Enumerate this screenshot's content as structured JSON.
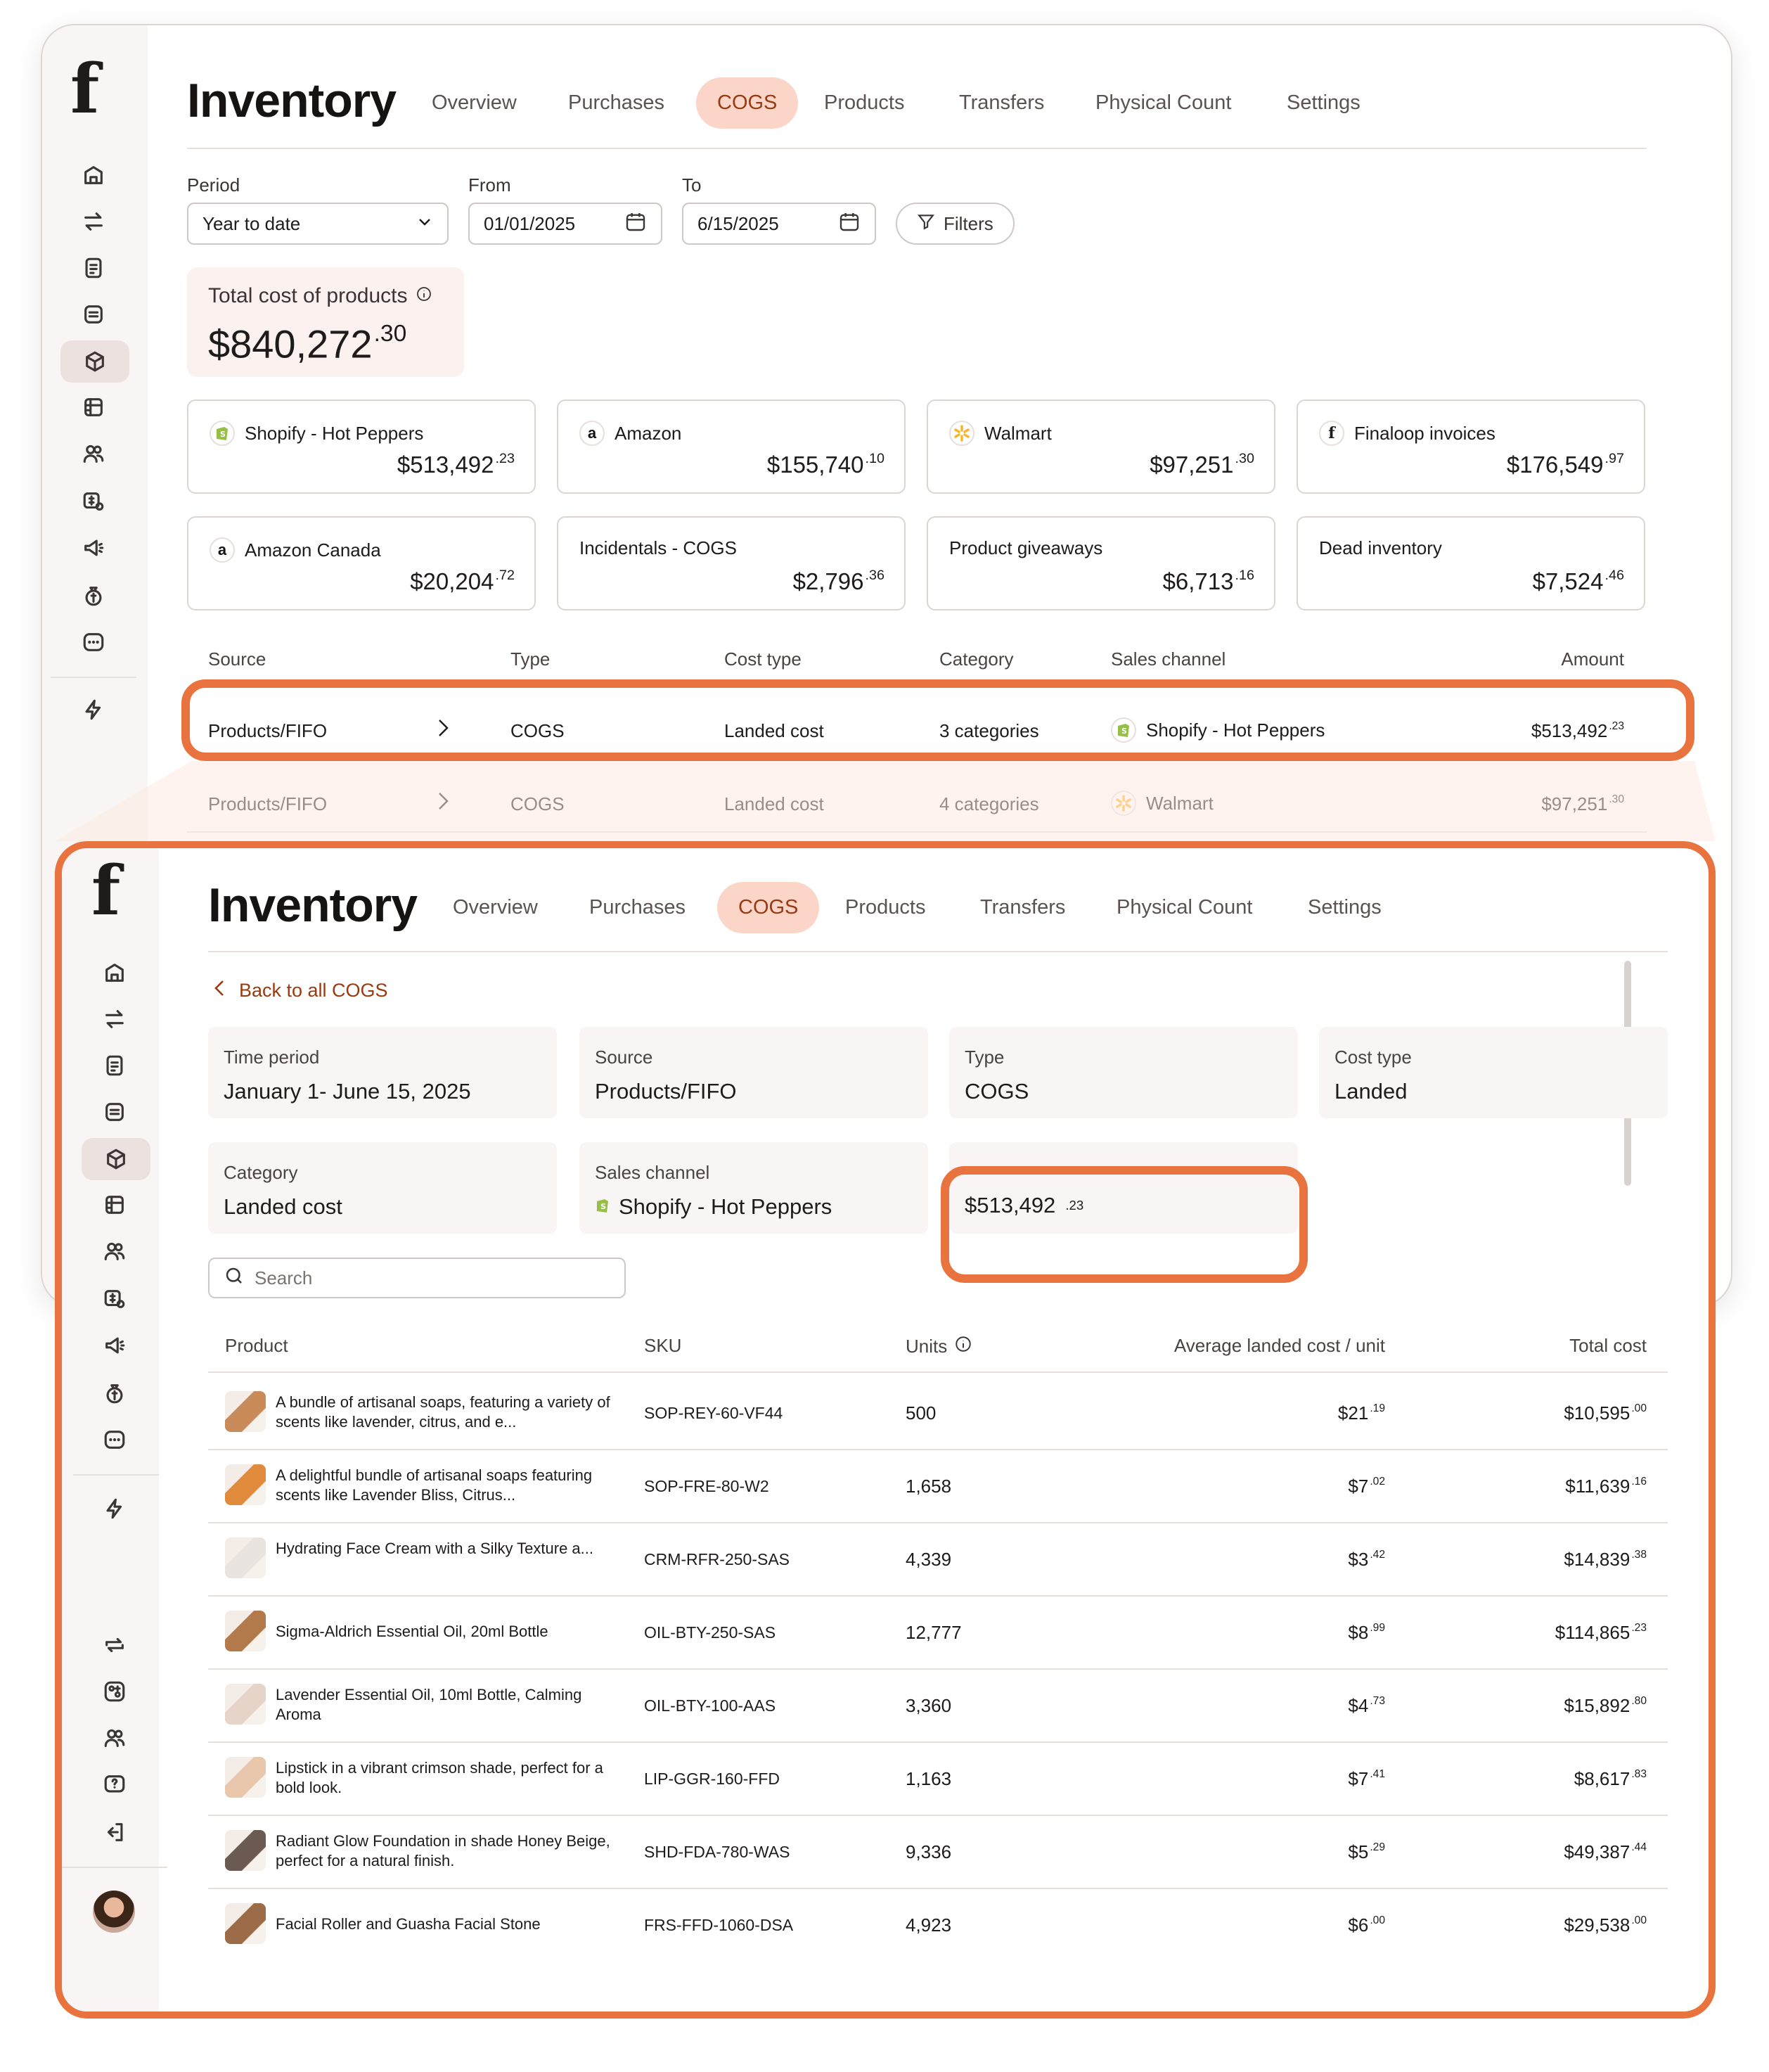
{
  "app": {
    "logo": "f",
    "title": "Inventory"
  },
  "tabs": [
    "Overview",
    "Purchases",
    "COGS",
    "Products",
    "Transfers",
    "Physical Count",
    "Settings"
  ],
  "active_tab": "COGS",
  "colors": {
    "accent": "#e8733f",
    "tab_active_bg": "#fbd6c8",
    "tab_active_text": "#9a3a12",
    "link": "#9a3a12"
  },
  "sidebar_icons": [
    "home-icon",
    "transfer-icon",
    "clipboard-icon",
    "list-icon",
    "box-icon",
    "store-icon",
    "users-icon",
    "customer-money-icon",
    "megaphone-icon",
    "money-bag-icon",
    "chat-icon",
    "bolt-icon"
  ],
  "sidebar_bottom_icons": [
    "sync-icon",
    "apps-icon",
    "team-icon",
    "help-icon",
    "logout-icon",
    "avatar"
  ],
  "filters": {
    "period_label": "Period",
    "period_value": "Year to date",
    "from_label": "From",
    "from_value": "01/01/2025",
    "to_label": "To",
    "to_value": "6/15/2025",
    "filters_button": "Filters"
  },
  "total": {
    "label": "Total cost of products",
    "value": "$840,272",
    "cents": ".30"
  },
  "channels": [
    {
      "name": "Shopify - Hot Peppers",
      "icon": "shopify-icon",
      "value": "$513,492",
      "cents": ".23"
    },
    {
      "name": "Amazon",
      "icon": "amazon-icon",
      "value": "$155,740",
      "cents": ".10"
    },
    {
      "name": "Walmart",
      "icon": "walmart-icon",
      "value": "$97,251",
      "cents": ".30"
    },
    {
      "name": "Finaloop invoices",
      "icon": "finaloop-icon",
      "value": "$176,549",
      "cents": ".97"
    },
    {
      "name": "Amazon Canada",
      "icon": "amazon-icon",
      "value": "$20,204",
      "cents": ".72"
    },
    {
      "name": "Incidentals - COGS",
      "icon": "",
      "value": "$2,796",
      "cents": ".36"
    },
    {
      "name": "Product giveaways",
      "icon": "",
      "value": "$6,713",
      "cents": ".16"
    },
    {
      "name": "Dead inventory",
      "icon": "",
      "value": "$7,524",
      "cents": ".46"
    }
  ],
  "source_table": {
    "headers": [
      "Source",
      "Type",
      "Cost type",
      "Category",
      "Sales channel",
      "Amount"
    ],
    "rows": [
      {
        "source": "Products/FIFO",
        "type": "COGS",
        "cost_type": "Landed cost",
        "category": "3 categories",
        "channel": "Shopify - Hot Peppers",
        "amount": "$513,492",
        "cents": ".23"
      },
      {
        "source": "Products/FIFO",
        "type": "COGS",
        "cost_type": "Landed cost",
        "category": "4 categories",
        "channel": "Walmart",
        "amount": "$97,251",
        "cents": ".30"
      }
    ]
  },
  "detail": {
    "back_link": "Back to all COGS",
    "cards": [
      {
        "label": "Time period",
        "value": "January 1- June 15, 2025"
      },
      {
        "label": "Source",
        "value": "Products/FIFO"
      },
      {
        "label": "Type",
        "value": "COGS"
      },
      {
        "label": "Cost type",
        "value": "Landed"
      },
      {
        "label": "Category",
        "value": "Landed cost"
      },
      {
        "label": "Sales channel",
        "value": "Shopify - Hot Peppers"
      }
    ],
    "amount": "$513,492",
    "amount_cents": ".23",
    "search_placeholder": "Search",
    "product_headers": [
      "Product",
      "SKU",
      "Units",
      "Average landed cost / unit",
      "Total cost"
    ],
    "products": [
      {
        "name": "A bundle of artisanal soaps, featuring a variety of scents like lavender, citrus, and e...",
        "sku": "SOP-REY-60-VF44",
        "units": "500",
        "avg": "$21",
        "avg_c": ".19",
        "total": "$10,595",
        "total_c": ".00",
        "thumb": "#c98b5a"
      },
      {
        "name": "A delightful bundle of artisanal soaps featuring scents like Lavender Bliss, Citrus...",
        "sku": "SOP-FRE-80-W2",
        "units": "1,658",
        "avg": "$7",
        "avg_c": ".02",
        "total": "$11,639",
        "total_c": ".16",
        "thumb": "#e08b3c"
      },
      {
        "name": "Hydrating Face Cream with a Silky Texture a...",
        "sku": "CRM-RFR-250-SAS",
        "units": "4,339",
        "avg": "$3",
        "avg_c": ".42",
        "total": "$14,839",
        "total_c": ".38",
        "thumb": "#e9e4e0"
      },
      {
        "name": "Sigma-Aldrich Essential Oil, 20ml Bottle",
        "sku": "OIL-BTY-250-SAS",
        "units": "12,777",
        "avg": "$8",
        "avg_c": ".99",
        "total": "$114,865",
        "total_c": ".23",
        "thumb": "#b27a4a"
      },
      {
        "name": "Lavender Essential Oil, 10ml Bottle, Calming Aroma",
        "sku": "OIL-BTY-100-AAS",
        "units": "3,360",
        "avg": "$4",
        "avg_c": ".73",
        "total": "$15,892",
        "total_c": ".80",
        "thumb": "#e7d4c8"
      },
      {
        "name": "Lipstick in a vibrant crimson shade, perfect for a bold look.",
        "sku": "LIP-GGR-160-FFD",
        "units": "1,163",
        "avg": "$7",
        "avg_c": ".41",
        "total": "$8,617",
        "total_c": ".83",
        "thumb": "#e9c7ad"
      },
      {
        "name": "Radiant Glow Foundation in shade Honey Beige, perfect for a natural finish.",
        "sku": "SHD-FDA-780-WAS",
        "units": "9,336",
        "avg": "$5",
        "avg_c": ".29",
        "total": "$49,387",
        "total_c": ".44",
        "thumb": "#6b5a52"
      },
      {
        "name": "Facial Roller and Guasha Facial Stone",
        "sku": "FRS-FFD-1060-DSA",
        "units": "4,923",
        "avg": "$6",
        "avg_c": ".00",
        "total": "$29,538",
        "total_c": ".00",
        "thumb": "#9c6b48"
      }
    ]
  }
}
